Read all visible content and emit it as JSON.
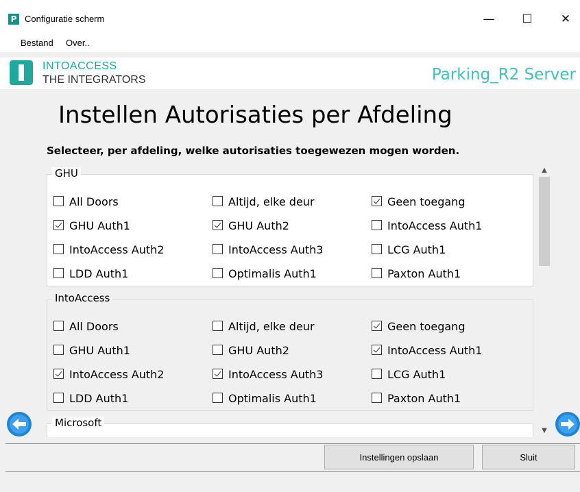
{
  "window": {
    "icon_letter": "P",
    "title": "Configuratie scherm",
    "minimize": "—",
    "maximize": "☐",
    "close": "✕"
  },
  "menu": {
    "items": [
      "Bestand",
      "Over.."
    ]
  },
  "logo": {
    "line1": "INTOACCESS",
    "line2": "THE INTEGRATORS"
  },
  "server_name": "Parking_R2 Server",
  "page_title": "Instellen Autorisaties per Afdeling",
  "subtitle": "Selecteer, per afdeling, welke autorisaties toegewezen mogen worden.",
  "groups": [
    {
      "name": "GHU",
      "options": [
        {
          "label": "All Doors",
          "checked": false
        },
        {
          "label": "Altijd, elke deur",
          "checked": false
        },
        {
          "label": "Geen toegang",
          "checked": true
        },
        {
          "label": "GHU  Auth1",
          "checked": true
        },
        {
          "label": "GHU  Auth2",
          "checked": true
        },
        {
          "label": "IntoAccess  Auth1",
          "checked": false
        },
        {
          "label": "IntoAccess  Auth2",
          "checked": false
        },
        {
          "label": "IntoAccess  Auth3",
          "checked": false
        },
        {
          "label": "LCG  Auth1",
          "checked": false
        },
        {
          "label": "LDD  Auth1",
          "checked": false
        },
        {
          "label": "Optimalis  Auth1",
          "checked": false
        },
        {
          "label": "Paxton  Auth1",
          "checked": false
        }
      ]
    },
    {
      "name": "IntoAccess",
      "options": [
        {
          "label": "All Doors",
          "checked": false
        },
        {
          "label": "Altijd, elke deur",
          "checked": false
        },
        {
          "label": "Geen toegang",
          "checked": true
        },
        {
          "label": "GHU  Auth1",
          "checked": false
        },
        {
          "label": "GHU  Auth2",
          "checked": false
        },
        {
          "label": "IntoAccess  Auth1",
          "checked": true
        },
        {
          "label": "IntoAccess  Auth2",
          "checked": true
        },
        {
          "label": "IntoAccess  Auth3",
          "checked": true
        },
        {
          "label": "LCG  Auth1",
          "checked": false
        },
        {
          "label": "LDD  Auth1",
          "checked": false
        },
        {
          "label": "Optimalis  Auth1",
          "checked": false
        },
        {
          "label": "Paxton  Auth1",
          "checked": false
        }
      ]
    },
    {
      "name": "Microsoft",
      "options": []
    }
  ],
  "scrollbar": {
    "up": "▲",
    "down": "▼"
  },
  "buttons": {
    "save": "Instellingen opslaan",
    "close": "Sluit"
  },
  "colors": {
    "accent": "#1fa89e",
    "server": "#42bfb7",
    "nav": "#1e84d6"
  }
}
